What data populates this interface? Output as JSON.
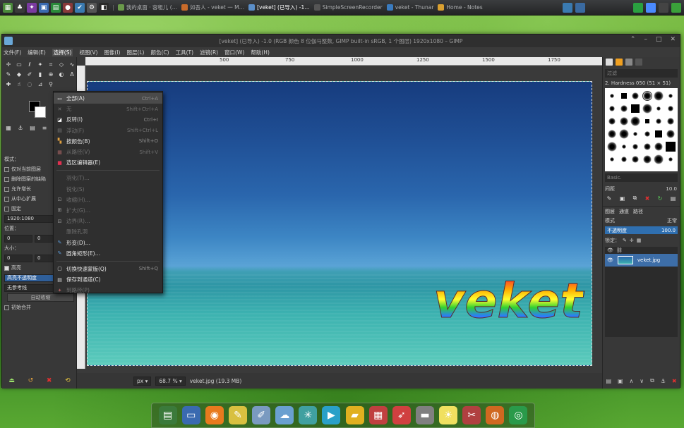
{
  "top_panel": {
    "sep1": "|",
    "tasks": [
      {
        "label": "我的桌面 · 容租儿 (…",
        "color": "#6a9a4a"
      },
      {
        "label": "如吾人 - veket 一 M…",
        "color": "#c96b2a"
      },
      {
        "label": "[veket] (已导入) -1…",
        "color": "#5b8fc9"
      },
      {
        "label": "SimpleScreenRecorder",
        "color": "#555555"
      },
      {
        "label": "veket - Thunar",
        "color": "#3a7bbf"
      },
      {
        "label": "Home - Notes",
        "color": "#d9a030"
      }
    ]
  },
  "window": {
    "title": "[veket] (已导入) -1.0 (RGB 颜色 8 位伽马整数, GIMP built-in sRGB, 1 个图层) 1920x1080 – GIMP",
    "controls": [
      "⌃",
      "–",
      "□",
      "✕"
    ]
  },
  "menubar": [
    "文件(F)",
    "编辑(E)",
    "选择(S)",
    "视图(V)",
    "图像(I)",
    "图层(L)",
    "颜色(C)",
    "工具(T)",
    "滤镜(R)",
    "窗口(W)",
    "帮助(H)"
  ],
  "select_menu": {
    "items": [
      {
        "label": "全部(A)",
        "shortcut": "Ctrl+A",
        "icon": "select-all-icon",
        "glyph": "▭",
        "disabled": false,
        "color": "#dddddd"
      },
      {
        "label": "无",
        "shortcut": "Shift+Ctrl+A",
        "icon": "select-none-icon",
        "glyph": "✕",
        "disabled": true,
        "color": "#777777"
      },
      {
        "label": "反转(I)",
        "shortcut": "Ctrl+I",
        "icon": "invert-icon",
        "glyph": "◪",
        "disabled": false,
        "color": "#ffffff"
      },
      {
        "label": "浮动(F)",
        "shortcut": "Shift+Ctrl+L",
        "icon": "float-icon",
        "glyph": "▤",
        "disabled": true,
        "color": "#777777"
      },
      {
        "label": "按颜色(B)",
        "shortcut": "Shift+O",
        "icon": "by-color-icon",
        "glyph": "▚",
        "disabled": false,
        "color": "#e0a040"
      },
      {
        "label": "从路径(V)",
        "shortcut": "Shift+V",
        "icon": "from-path-icon",
        "glyph": "▦",
        "disabled": true,
        "color": "#a06060"
      },
      {
        "label": "选区编辑器(E)",
        "shortcut": "",
        "icon": "selection-editor-icon",
        "glyph": "■",
        "disabled": false,
        "color": "#e03050"
      },
      {
        "sep": true
      },
      {
        "label": "羽化(T)…",
        "shortcut": "",
        "icon": "",
        "glyph": "",
        "disabled": true,
        "color": "#777777"
      },
      {
        "label": "锐化(S)",
        "shortcut": "",
        "icon": "",
        "glyph": "",
        "disabled": true,
        "color": "#777777"
      },
      {
        "label": "收缩(H)…",
        "shortcut": "",
        "icon": "shrink-icon",
        "glyph": "⊡",
        "disabled": true,
        "color": "#999999"
      },
      {
        "label": "扩大(G)…",
        "shortcut": "",
        "icon": "grow-icon",
        "glyph": "⊞",
        "disabled": true,
        "color": "#999999"
      },
      {
        "label": "边界(R)…",
        "shortcut": "",
        "icon": "border-icon",
        "glyph": "⊟",
        "disabled": true,
        "color": "#999999"
      },
      {
        "label": "删除孔洞",
        "shortcut": "",
        "icon": "",
        "glyph": "",
        "disabled": true,
        "color": "#777777"
      },
      {
        "label": "形变(D)…",
        "shortcut": "",
        "icon": "distort-icon",
        "glyph": "✎",
        "disabled": false,
        "color": "#5b9ad9"
      },
      {
        "label": "圆角矩形(E)…",
        "shortcut": "",
        "icon": "rounded-rect-icon",
        "glyph": "✎",
        "disabled": false,
        "color": "#5b9ad9"
      },
      {
        "sep": true
      },
      {
        "label": "切换快速蒙版(Q)",
        "shortcut": "Shift+Q",
        "icon": "quick-mask-icon",
        "glyph": "▢",
        "disabled": false,
        "color": "#dddddd"
      },
      {
        "label": "保存到通道(C)",
        "shortcut": "",
        "icon": "save-channel-icon",
        "glyph": "▤",
        "disabled": false,
        "color": "#dddddd"
      },
      {
        "label": "到路径(P)",
        "shortcut": "",
        "icon": "to-path-icon",
        "glyph": "✦",
        "disabled": true,
        "color": "#b06060"
      }
    ]
  },
  "tool_options": {
    "rows": [
      {
        "type": "header",
        "label": "模式："
      },
      {
        "type": "check",
        "label": "仅对当前图层",
        "checked": false
      },
      {
        "type": "check",
        "label": "删除图案的缺陷",
        "checked": false
      },
      {
        "type": "check",
        "label": "允许增长",
        "checked": false
      },
      {
        "type": "check",
        "label": "从中心扩展",
        "checked": false
      },
      {
        "type": "check",
        "label": "固定",
        "checked": false,
        "extra": "宽"
      },
      {
        "type": "field",
        "label": "1920:1080"
      },
      {
        "type": "label",
        "label": "位置："
      },
      {
        "type": "spin",
        "value": "0",
        "value2": "0"
      },
      {
        "type": "label",
        "label": "大小："
      },
      {
        "type": "spin",
        "value": "0",
        "value2": "0"
      },
      {
        "type": "check",
        "label": "高亮",
        "checked": true
      },
      {
        "type": "blue",
        "label": "高亮不透明度",
        "value": "50.0"
      },
      {
        "type": "field",
        "label": "无参考线"
      },
      {
        "type": "button",
        "label": "自动收缩"
      },
      {
        "type": "check",
        "label": "初始合并",
        "checked": false
      }
    ]
  },
  "ruler_marks": [
    "500",
    "750",
    "1000",
    "1250",
    "1500",
    "1750"
  ],
  "canvas": {
    "overlay_text": "veket"
  },
  "statusbar": {
    "unit": "px",
    "zoom": "68.7 %",
    "file": "veket.jpg (19.3 MB)"
  },
  "brushes": {
    "filter_placeholder": "过滤",
    "title": "2. Hardness 050 (51 × 51)",
    "preset": "Basic.",
    "spacing_label": "间距",
    "spacing_value": "10.0"
  },
  "layers": {
    "tabs": [
      "图层",
      "通道",
      "路径"
    ],
    "mode_label": "模式",
    "mode_value": "正常",
    "opacity_label": "不透明度",
    "opacity_value": "100.0",
    "lock_label": "锁定：",
    "layer_name": "veket.jpg"
  },
  "dock_apps": [
    {
      "name": "terminal-icon",
      "glyph": "▤",
      "color": "#3b7a3b"
    },
    {
      "name": "monitor-icon",
      "glyph": "▭",
      "color": "#3a6ab0"
    },
    {
      "name": "firefox-icon",
      "glyph": "◉",
      "color": "#e87a1e"
    },
    {
      "name": "text-editor-icon",
      "glyph": "✎",
      "color": "#d8c040"
    },
    {
      "name": "paint-icon",
      "glyph": "✐",
      "color": "#7a9ac0"
    },
    {
      "name": "network-icon",
      "glyph": "☁",
      "color": "#6aa0d0"
    },
    {
      "name": "molecule-icon",
      "glyph": "✳",
      "color": "#40a0a0"
    },
    {
      "name": "media-player-icon",
      "glyph": "▶",
      "color": "#2aa0c8"
    },
    {
      "name": "folder-icon",
      "glyph": "▰",
      "color": "#e0b020"
    },
    {
      "name": "image-viewer-icon",
      "glyph": "▦",
      "color": "#c04040"
    },
    {
      "name": "rocket-icon",
      "glyph": "➶",
      "color": "#d04040"
    },
    {
      "name": "drive-icon",
      "glyph": "▬",
      "color": "#808080"
    },
    {
      "name": "sun-icon",
      "glyph": "☀",
      "color": "#f0e060"
    },
    {
      "name": "tools-icon",
      "glyph": "✂",
      "color": "#b04040"
    },
    {
      "name": "firefox-alt-icon",
      "glyph": "◍",
      "color": "#d06820"
    },
    {
      "name": "globe-icon",
      "glyph": "◎",
      "color": "#2a9a4a"
    }
  ]
}
